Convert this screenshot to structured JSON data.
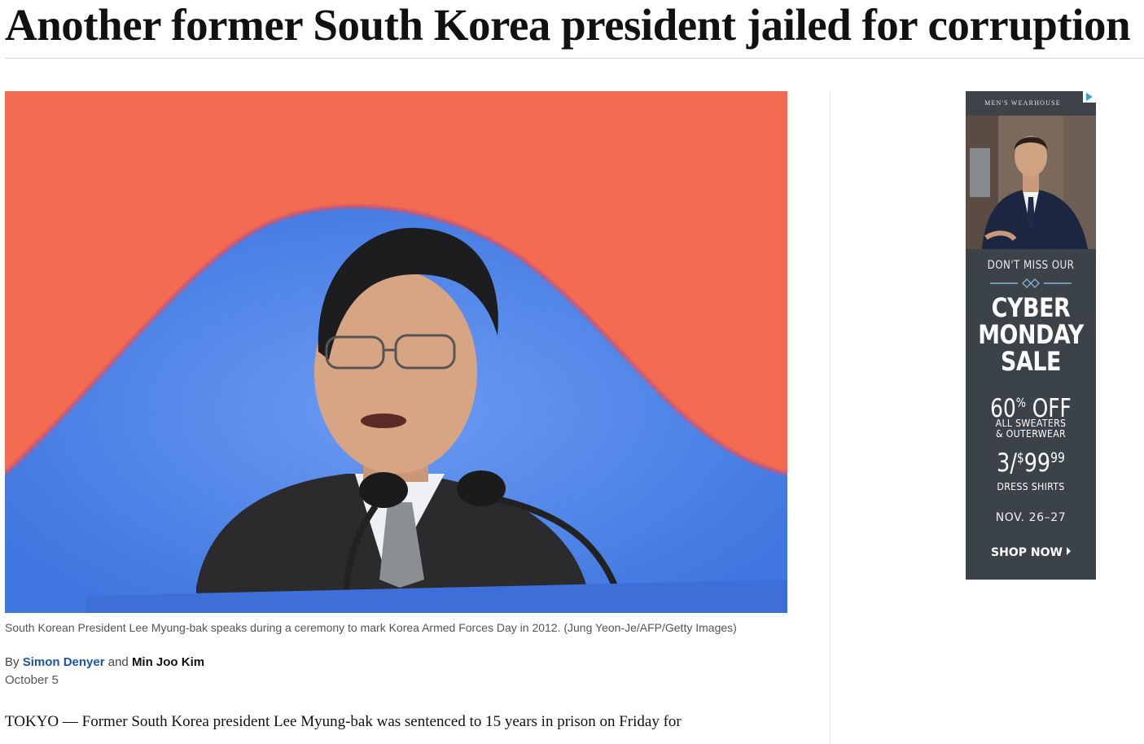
{
  "article": {
    "headline": "Another former South Korea president jailed for corruption",
    "caption": "South Korean President Lee Myung-bak speaks during a ceremony to mark Korea Armed Forces Day in 2012. (Jung Yeon-Je/AFP/Getty Images)",
    "byline": {
      "prefix": "By",
      "author1": "Simon Denyer",
      "conjunction": "and",
      "author2": "Min Joo Kim"
    },
    "date": "October 5",
    "lede": "TOKYO — Former South Korea president Lee Myung-bak was sentenced to 15 years in prison on Friday for"
  },
  "ad": {
    "brand": "MEN'S WEARHOUSE",
    "dont_miss": "DON'T MISS OUR",
    "cyber_line1": "CYBER",
    "cyber_line2": "MONDAY",
    "cyber_line3": "SALE",
    "pct_value": "60",
    "pct_symbol": "%",
    "pct_off": " OFF",
    "sweaters_line1": "ALL SWEATERS",
    "sweaters_line2": "& OUTERWEAR",
    "price_prefix": "3/",
    "price_dollar": "$",
    "price_main": "99",
    "price_cents": "99",
    "dress_shirts": "DRESS SHIRTS",
    "dates": "NOV. 26–27",
    "shop_now": "SHOP NOW",
    "adchoices_icon": "adchoices-icon"
  },
  "colors": {
    "link": "#1955a5",
    "flag_red": "#f26a50",
    "flag_blue": "#4d86ea",
    "ad_bg": "#3b4248"
  }
}
